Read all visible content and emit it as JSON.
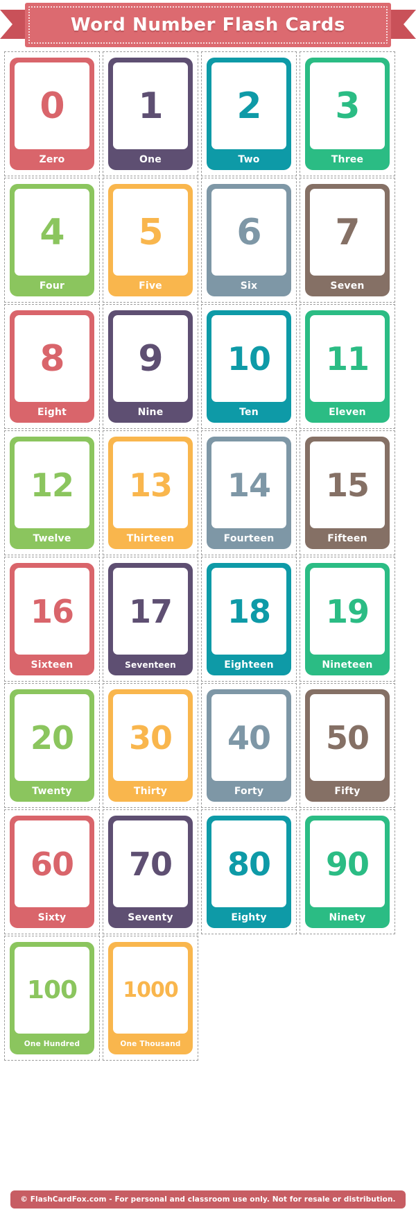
{
  "header": {
    "title": "Word Number Flash Cards",
    "ribbon_color": "#DC6A70",
    "ribbon_tail_color": "#C95159",
    "ribbon_dot_border_color": "#F6DADC"
  },
  "palette": {
    "red": "#D9656B",
    "purple": "#5E4F72",
    "teal": "#0E9AA7",
    "green": "#2BBC84",
    "olive": "#8BC55E",
    "amber": "#F9B64D",
    "slate": "#7E97A6",
    "brown": "#857065"
  },
  "cards": [
    {
      "number": "0",
      "word": "Zero",
      "color": "#D9656B"
    },
    {
      "number": "1",
      "word": "One",
      "color": "#5E4F72"
    },
    {
      "number": "2",
      "word": "Two",
      "color": "#0E9AA7"
    },
    {
      "number": "3",
      "word": "Three",
      "color": "#2BBC84"
    },
    {
      "number": "4",
      "word": "Four",
      "color": "#8BC55E"
    },
    {
      "number": "5",
      "word": "Five",
      "color": "#F9B64D"
    },
    {
      "number": "6",
      "word": "Six",
      "color": "#7E97A6"
    },
    {
      "number": "7",
      "word": "Seven",
      "color": "#857065"
    },
    {
      "number": "8",
      "word": "Eight",
      "color": "#D9656B"
    },
    {
      "number": "9",
      "word": "Nine",
      "color": "#5E4F72"
    },
    {
      "number": "10",
      "word": "Ten",
      "color": "#0E9AA7"
    },
    {
      "number": "11",
      "word": "Eleven",
      "color": "#2BBC84"
    },
    {
      "number": "12",
      "word": "Twelve",
      "color": "#8BC55E"
    },
    {
      "number": "13",
      "word": "Thirteen",
      "color": "#F9B64D"
    },
    {
      "number": "14",
      "word": "Fourteen",
      "color": "#7E97A6"
    },
    {
      "number": "15",
      "word": "Fifteen",
      "color": "#857065"
    },
    {
      "number": "16",
      "word": "Sixteen",
      "color": "#D9656B"
    },
    {
      "number": "17",
      "word": "Seventeen",
      "color": "#5E4F72"
    },
    {
      "number": "18",
      "word": "Eighteen",
      "color": "#0E9AA7"
    },
    {
      "number": "19",
      "word": "Nineteen",
      "color": "#2BBC84"
    },
    {
      "number": "20",
      "word": "Twenty",
      "color": "#8BC55E"
    },
    {
      "number": "30",
      "word": "Thirty",
      "color": "#F9B64D"
    },
    {
      "number": "40",
      "word": "Forty",
      "color": "#7E97A6"
    },
    {
      "number": "50",
      "word": "Fifty",
      "color": "#857065"
    },
    {
      "number": "60",
      "word": "Sixty",
      "color": "#D9656B"
    },
    {
      "number": "70",
      "word": "Seventy",
      "color": "#5E4F72"
    },
    {
      "number": "80",
      "word": "Eighty",
      "color": "#0E9AA7"
    },
    {
      "number": "90",
      "word": "Ninety",
      "color": "#2BBC84"
    },
    {
      "number": "100",
      "word": "One Hundred",
      "color": "#8BC55E"
    },
    {
      "number": "1000",
      "word": "One Thousand",
      "color": "#F9B64D"
    }
  ],
  "grid": {
    "columns": 4,
    "rows": 8,
    "total_cards": 30
  },
  "footer": {
    "text": "© FlashCardFox.com - For personal and classroom use only. Not for resale or distribution.",
    "background_color": "#C75D63"
  }
}
